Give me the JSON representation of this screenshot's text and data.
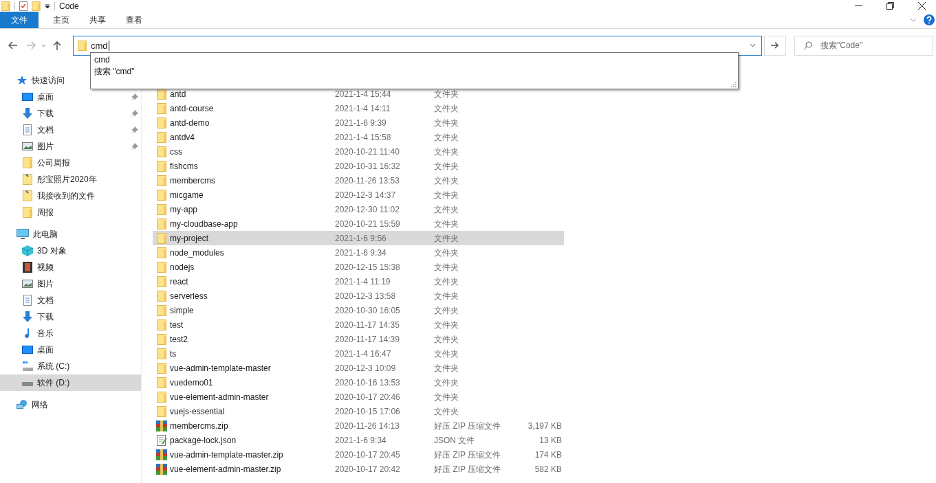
{
  "window": {
    "title": "Code"
  },
  "ribbon_tabs": [
    {
      "label": "文件",
      "selected": true
    },
    {
      "label": "主页",
      "selected": false
    },
    {
      "label": "共享",
      "selected": false
    },
    {
      "label": "查看",
      "selected": false
    }
  ],
  "address_bar": {
    "value": "cmd"
  },
  "autocomplete": [
    "cmd",
    "搜索 \"cmd\""
  ],
  "search": {
    "placeholder": "搜索\"Code\""
  },
  "sidebar": [
    {
      "label": "快速访问",
      "kind": "star",
      "selected": false,
      "children": [
        {
          "label": "桌面",
          "kind": "desktop",
          "pinned": true,
          "selected": false
        },
        {
          "label": "下载",
          "kind": "download",
          "pinned": true,
          "selected": false
        },
        {
          "label": "文档",
          "kind": "document",
          "pinned": true,
          "selected": false
        },
        {
          "label": "图片",
          "kind": "picture",
          "pinned": true,
          "selected": false
        },
        {
          "label": "公司周报",
          "kind": "folder",
          "pinned": false,
          "selected": false
        },
        {
          "label": "彤宝照片2020年",
          "kind": "shared",
          "pinned": false,
          "selected": false
        },
        {
          "label": "我接收到的文件",
          "kind": "shared",
          "pinned": false,
          "selected": false
        },
        {
          "label": "周报",
          "kind": "folder",
          "pinned": false,
          "selected": false
        }
      ]
    },
    {
      "label": "此电脑",
      "kind": "pc",
      "selected": false,
      "children": [
        {
          "label": "3D 对象",
          "kind": "cube",
          "selected": false
        },
        {
          "label": "视频",
          "kind": "video",
          "selected": false
        },
        {
          "label": "图片",
          "kind": "picture",
          "selected": false
        },
        {
          "label": "文档",
          "kind": "document",
          "selected": false
        },
        {
          "label": "下载",
          "kind": "download",
          "selected": false
        },
        {
          "label": "音乐",
          "kind": "music",
          "selected": false
        },
        {
          "label": "桌面",
          "kind": "desktop",
          "selected": false
        },
        {
          "label": "系统 (C:)",
          "kind": "system-drive",
          "selected": false
        },
        {
          "label": "软件 (D:)",
          "kind": "drive",
          "selected": true
        }
      ]
    },
    {
      "label": "网络",
      "kind": "network",
      "selected": false
    }
  ],
  "files": [
    {
      "name": "antd",
      "date": "2021-1-4 15:44",
      "type": "文件夹",
      "kind": "folder",
      "selected": false
    },
    {
      "name": "antd-course",
      "date": "2021-1-4 14:11",
      "type": "文件夹",
      "kind": "folder",
      "selected": false
    },
    {
      "name": "antd-demo",
      "date": "2021-1-6 9:39",
      "type": "文件夹",
      "kind": "folder",
      "selected": false
    },
    {
      "name": "antdv4",
      "date": "2021-1-4 15:58",
      "type": "文件夹",
      "kind": "folder",
      "selected": false
    },
    {
      "name": "css",
      "date": "2020-10-21 11:40",
      "type": "文件夹",
      "kind": "folder",
      "selected": false
    },
    {
      "name": "fishcms",
      "date": "2020-10-31 16:32",
      "type": "文件夹",
      "kind": "folder",
      "selected": false
    },
    {
      "name": "membercms",
      "date": "2020-11-26 13:53",
      "type": "文件夹",
      "kind": "folder",
      "selected": false
    },
    {
      "name": "micgame",
      "date": "2020-12-3 14:37",
      "type": "文件夹",
      "kind": "folder",
      "selected": false
    },
    {
      "name": "my-app",
      "date": "2020-12-30 11:02",
      "type": "文件夹",
      "kind": "folder",
      "selected": false
    },
    {
      "name": "my-cloudbase-app",
      "date": "2020-10-21 15:59",
      "type": "文件夹",
      "kind": "folder",
      "selected": false
    },
    {
      "name": "my-project",
      "date": "2021-1-6 9:56",
      "type": "文件夹",
      "kind": "folder",
      "selected": true
    },
    {
      "name": "node_modules",
      "date": "2021-1-6 9:34",
      "type": "文件夹",
      "kind": "folder",
      "selected": false
    },
    {
      "name": "nodejs",
      "date": "2020-12-15 15:38",
      "type": "文件夹",
      "kind": "folder",
      "selected": false
    },
    {
      "name": "react",
      "date": "2021-1-4 11:19",
      "type": "文件夹",
      "kind": "folder",
      "selected": false
    },
    {
      "name": "serverless",
      "date": "2020-12-3 13:58",
      "type": "文件夹",
      "kind": "folder",
      "selected": false
    },
    {
      "name": "simple",
      "date": "2020-10-30 16:05",
      "type": "文件夹",
      "kind": "folder",
      "selected": false
    },
    {
      "name": "test",
      "date": "2020-11-17 14:35",
      "type": "文件夹",
      "kind": "folder",
      "selected": false
    },
    {
      "name": "test2",
      "date": "2020-11-17 14:39",
      "type": "文件夹",
      "kind": "folder",
      "selected": false
    },
    {
      "name": "ts",
      "date": "2021-1-4 16:47",
      "type": "文件夹",
      "kind": "folder",
      "selected": false
    },
    {
      "name": "vue-admin-template-master",
      "date": "2020-12-3 10:09",
      "type": "文件夹",
      "kind": "folder",
      "selected": false
    },
    {
      "name": "vuedemo01",
      "date": "2020-10-16 13:53",
      "type": "文件夹",
      "kind": "folder",
      "selected": false
    },
    {
      "name": "vue-element-admin-master",
      "date": "2020-10-17 20:46",
      "type": "文件夹",
      "kind": "folder",
      "selected": false
    },
    {
      "name": "vuejs-essential",
      "date": "2020-10-15 17:06",
      "type": "文件夹",
      "kind": "folder",
      "selected": false
    },
    {
      "name": "membercms.zip",
      "date": "2020-11-26 14:13",
      "type": "好压 ZIP 压缩文件",
      "size": "3,197 KB",
      "kind": "zip",
      "selected": false
    },
    {
      "name": "package-lock.json",
      "date": "2021-1-6 9:34",
      "type": "JSON 文件",
      "size": "13 KB",
      "kind": "json",
      "selected": false
    },
    {
      "name": "vue-admin-template-master.zip",
      "date": "2020-10-17 20:45",
      "type": "好压 ZIP 压缩文件",
      "size": "174 KB",
      "kind": "zip",
      "selected": false
    },
    {
      "name": "vue-element-admin-master.zip",
      "date": "2020-10-17 20:42",
      "type": "好压 ZIP 压缩文件",
      "size": "582 KB",
      "kind": "zip",
      "selected": false
    }
  ]
}
